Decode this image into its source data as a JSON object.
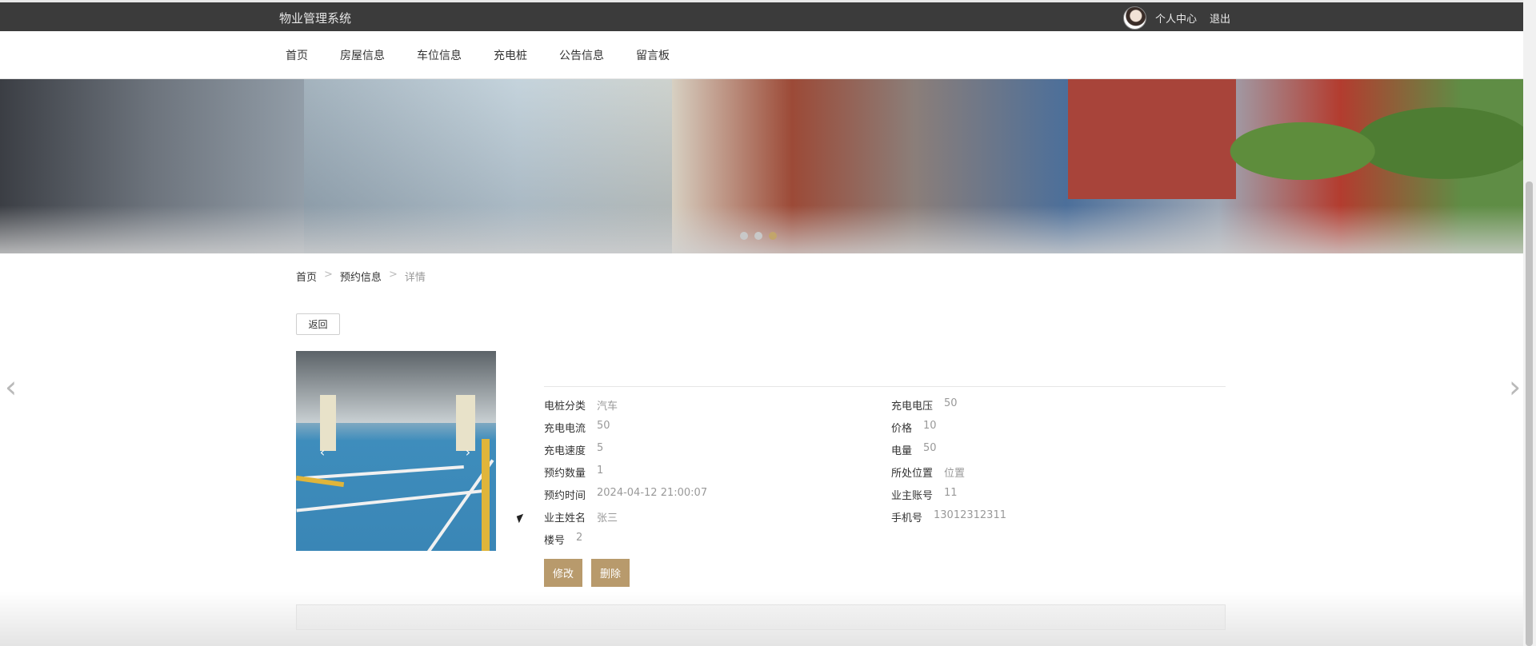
{
  "header": {
    "site_title": "物业管理系统",
    "user_center": "个人中心",
    "logout": "退出"
  },
  "nav": {
    "items": [
      {
        "label": "首页"
      },
      {
        "label": "房屋信息"
      },
      {
        "label": "车位信息"
      },
      {
        "label": "充电桩"
      },
      {
        "label": "公告信息"
      },
      {
        "label": "留言板"
      }
    ]
  },
  "banner": {
    "slide_count": 3,
    "active_slide": 3
  },
  "breadcrumb": {
    "home": "首页",
    "section": "预约信息",
    "current": "详情",
    "separator": ">"
  },
  "actions": {
    "back": "返回",
    "edit": "修改",
    "delete": "删除"
  },
  "gallery": {
    "prev_icon": "‹",
    "next_icon": "›"
  },
  "details": {
    "left": [
      {
        "label": "电桩分类",
        "value": "汽车"
      },
      {
        "label": "充电电流",
        "value": "50"
      },
      {
        "label": "充电速度",
        "value": "5"
      },
      {
        "label": "预约数量",
        "value": "1"
      },
      {
        "label": "预约时间",
        "value": "2024-04-12 21:00:07"
      },
      {
        "label": "业主姓名",
        "value": "张三"
      },
      {
        "label": "楼号",
        "value": "2"
      }
    ],
    "right": [
      {
        "label": "充电电压",
        "value": "50"
      },
      {
        "label": "价格",
        "value": "10"
      },
      {
        "label": "电量",
        "value": "50"
      },
      {
        "label": "所处位置",
        "value": "位置"
      },
      {
        "label": "业主账号",
        "value": "11"
      },
      {
        "label": "手机号",
        "value": "13012312311"
      }
    ]
  },
  "side_arrows": {
    "prev": "‹",
    "next": "›"
  },
  "colors": {
    "accent": "#b89a6c",
    "topbar": "#3b3b3b"
  }
}
